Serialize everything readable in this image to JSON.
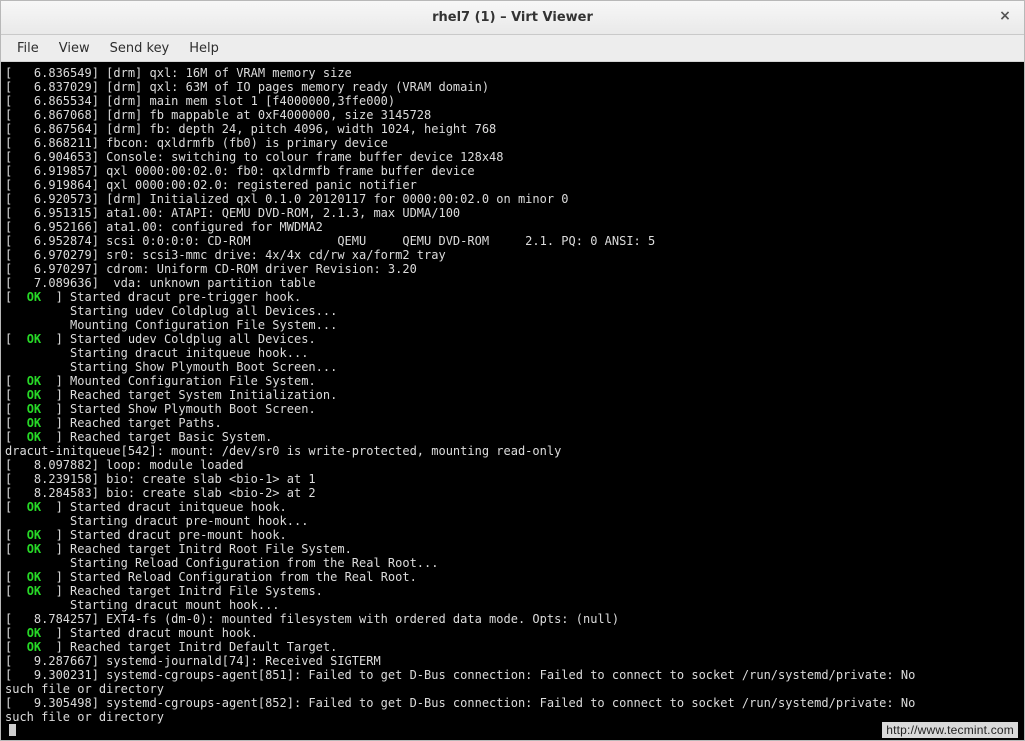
{
  "window": {
    "title": "rhel7 (1) – Virt Viewer",
    "close_glyph": "×"
  },
  "menubar": {
    "items": [
      {
        "label": "File"
      },
      {
        "label": "View"
      },
      {
        "label": "Send key"
      },
      {
        "label": "Help"
      }
    ]
  },
  "watermark": "http://www.tecmint.com",
  "log_lines": [
    {
      "t": "kern",
      "ts": "6.836549",
      "msg": "[drm] qxl: 16M of VRAM memory size"
    },
    {
      "t": "kern",
      "ts": "6.837029",
      "msg": "[drm] qxl: 63M of IO pages memory ready (VRAM domain)"
    },
    {
      "t": "kern",
      "ts": "6.865534",
      "msg": "[drm] main mem slot 1 [f4000000,3ffe000)"
    },
    {
      "t": "kern",
      "ts": "6.867068",
      "msg": "[drm] fb mappable at 0xF4000000, size 3145728"
    },
    {
      "t": "kern",
      "ts": "6.867564",
      "msg": "[drm] fb: depth 24, pitch 4096, width 1024, height 768"
    },
    {
      "t": "kern",
      "ts": "6.868211",
      "msg": "fbcon: qxldrmfb (fb0) is primary device"
    },
    {
      "t": "kern",
      "ts": "6.904653",
      "msg": "Console: switching to colour frame buffer device 128x48"
    },
    {
      "t": "kern",
      "ts": "6.919857",
      "msg": "qxl 0000:00:02.0: fb0: qxldrmfb frame buffer device"
    },
    {
      "t": "kern",
      "ts": "6.919864",
      "msg": "qxl 0000:00:02.0: registered panic notifier"
    },
    {
      "t": "kern",
      "ts": "6.920573",
      "msg": "[drm] Initialized qxl 0.1.0 20120117 for 0000:00:02.0 on minor 0"
    },
    {
      "t": "kern",
      "ts": "6.951315",
      "msg": "ata1.00: ATAPI: QEMU DVD-ROM, 2.1.3, max UDMA/100"
    },
    {
      "t": "kern",
      "ts": "6.952166",
      "msg": "ata1.00: configured for MWDMA2"
    },
    {
      "t": "kern",
      "ts": "6.952874",
      "msg": "scsi 0:0:0:0: CD-ROM            QEMU     QEMU DVD-ROM     2.1. PQ: 0 ANSI: 5"
    },
    {
      "t": "kern",
      "ts": "6.970279",
      "msg": "sr0: scsi3-mmc drive: 4x/4x cd/rw xa/form2 tray"
    },
    {
      "t": "kern",
      "ts": "6.970297",
      "msg": "cdrom: Uniform CD-ROM driver Revision: 3.20"
    },
    {
      "t": "kern",
      "ts": "7.089636",
      "msg": " vda: unknown partition table"
    },
    {
      "t": "ok",
      "msg": "Started dracut pre-trigger hook."
    },
    {
      "t": "start",
      "msg": "Starting udev Coldplug all Devices..."
    },
    {
      "t": "start",
      "msg": "Mounting Configuration File System..."
    },
    {
      "t": "ok",
      "msg": "Started udev Coldplug all Devices."
    },
    {
      "t": "start",
      "msg": "Starting dracut initqueue hook..."
    },
    {
      "t": "start",
      "msg": "Starting Show Plymouth Boot Screen..."
    },
    {
      "t": "ok",
      "msg": "Mounted Configuration File System."
    },
    {
      "t": "ok",
      "msg": "Reached target System Initialization."
    },
    {
      "t": "ok",
      "msg": "Started Show Plymouth Boot Screen."
    },
    {
      "t": "ok",
      "msg": "Reached target Paths."
    },
    {
      "t": "ok",
      "msg": "Reached target Basic System."
    },
    {
      "t": "plain",
      "msg": "dracut-initqueue[542]: mount: /dev/sr0 is write-protected, mounting read-only"
    },
    {
      "t": "kern",
      "ts": "8.097882",
      "msg": "loop: module loaded"
    },
    {
      "t": "kern",
      "ts": "8.239158",
      "msg": "bio: create slab <bio-1> at 1"
    },
    {
      "t": "kern",
      "ts": "8.284583",
      "msg": "bio: create slab <bio-2> at 2"
    },
    {
      "t": "ok",
      "msg": "Started dracut initqueue hook."
    },
    {
      "t": "start",
      "msg": "Starting dracut pre-mount hook..."
    },
    {
      "t": "ok",
      "msg": "Started dracut pre-mount hook."
    },
    {
      "t": "ok",
      "msg": "Reached target Initrd Root File System."
    },
    {
      "t": "start",
      "msg": "Starting Reload Configuration from the Real Root..."
    },
    {
      "t": "ok",
      "msg": "Started Reload Configuration from the Real Root."
    },
    {
      "t": "ok",
      "msg": "Reached target Initrd File Systems."
    },
    {
      "t": "start",
      "msg": "Starting dracut mount hook..."
    },
    {
      "t": "kern",
      "ts": "8.784257",
      "msg": "EXT4-fs (dm-0): mounted filesystem with ordered data mode. Opts: (null)"
    },
    {
      "t": "ok",
      "msg": "Started dracut mount hook."
    },
    {
      "t": "ok",
      "msg": "Reached target Initrd Default Target."
    },
    {
      "t": "kern",
      "ts": "9.287667",
      "msg": "systemd-journald[74]: Received SIGTERM"
    },
    {
      "t": "kern",
      "ts": "9.300231",
      "msg": "systemd-cgroups-agent[851]: Failed to get D-Bus connection: Failed to connect to socket /run/systemd/private: No"
    },
    {
      "t": "plain",
      "msg": "such file or directory"
    },
    {
      "t": "kern",
      "ts": "9.305498",
      "msg": "systemd-cgroups-agent[852]: Failed to get D-Bus connection: Failed to connect to socket /run/systemd/private: No"
    },
    {
      "t": "plain",
      "msg": "such file or directory"
    }
  ]
}
